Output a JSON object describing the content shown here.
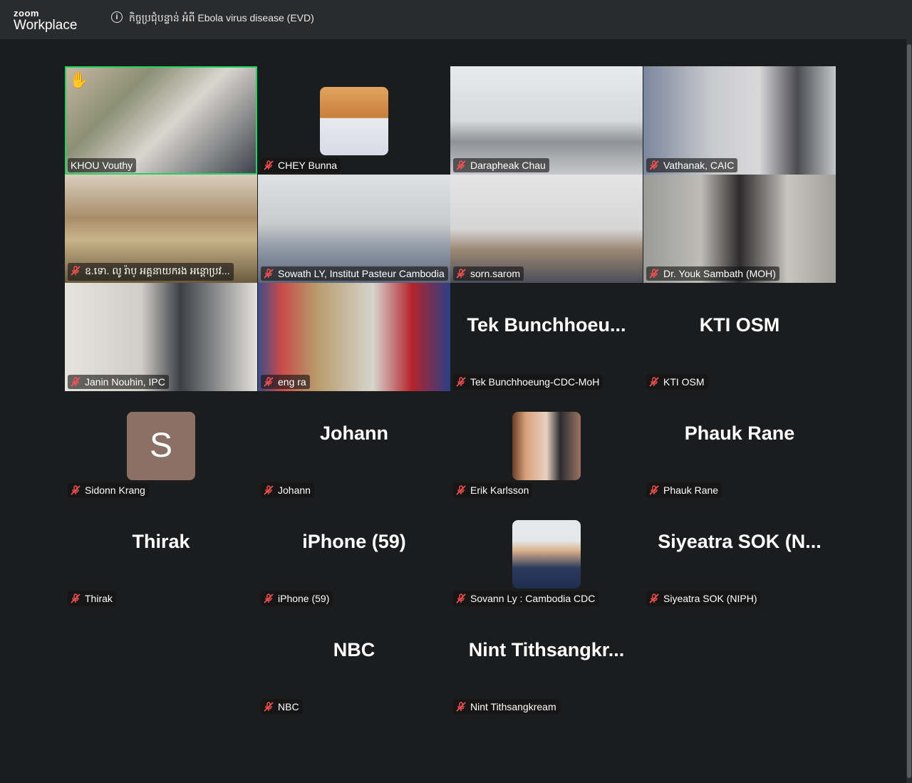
{
  "app": {
    "brand_top": "zoom",
    "brand_bottom": "Workplace"
  },
  "meeting": {
    "title": "កិច្ចប្រជុំបន្ទាន់ អំពី Ebola virus disease (EVD)"
  },
  "participants": [
    {
      "name": "KHOU Vouthy",
      "kind": "video",
      "hand_raised": true,
      "active_speaker": true,
      "muted": false
    },
    {
      "name": "CHEY Bunna",
      "kind": "avatar-photo",
      "muted": true
    },
    {
      "name": "Darapheak Chau",
      "kind": "video",
      "muted": true
    },
    {
      "name": "Vathanak, CAIC",
      "kind": "video",
      "muted": true
    },
    {
      "name": "ឧ.ទោ. លូ រ៉ាប្ អគ្គនាយករង អន្តោប្រវ...",
      "kind": "video",
      "muted": true
    },
    {
      "name": "Sowath LY, Institut Pasteur Cambodia",
      "kind": "video",
      "muted": true
    },
    {
      "name": "sorn.sarom",
      "kind": "video",
      "muted": true
    },
    {
      "name": "Dr. Youk Sambath (MOH)",
      "kind": "video",
      "muted": true
    },
    {
      "name": "Janin Nouhin, IPC",
      "kind": "video",
      "muted": true
    },
    {
      "name": "eng ra",
      "kind": "video",
      "muted": true
    },
    {
      "name": "Tek Bunchhoeung-CDC-MoH",
      "display": "Tek  Bunchhoeu...",
      "kind": "name",
      "muted": true
    },
    {
      "name": "KTI OSM",
      "display": "KTI OSM",
      "kind": "name",
      "muted": true
    },
    {
      "name": "Sidonn Krang",
      "initial": "S",
      "kind": "avatar-letter",
      "muted": true
    },
    {
      "name": "Johann",
      "display": "Johann",
      "kind": "name",
      "muted": true
    },
    {
      "name": "Erik Karlsson",
      "kind": "avatar-photo",
      "muted": true
    },
    {
      "name": "Phauk Rane",
      "display": "Phauk Rane",
      "kind": "name",
      "muted": true
    },
    {
      "name": "Thirak",
      "display": "Thirak",
      "kind": "name",
      "muted": true
    },
    {
      "name": "iPhone (59)",
      "display": "iPhone (59)",
      "kind": "name",
      "muted": true
    },
    {
      "name": "Sovann Ly : Cambodia CDC",
      "kind": "avatar-photo",
      "muted": true
    },
    {
      "name": "Siyeatra SOK (NIPH)",
      "display": "Siyeatra  SOK  (N...",
      "kind": "name",
      "muted": true
    },
    {
      "name": "NBC",
      "display": "NBC",
      "kind": "name",
      "muted": true
    },
    {
      "name": "Nint Tithsangkream",
      "display": "Nint  Tithsangkr...",
      "kind": "name",
      "muted": true
    }
  ]
}
